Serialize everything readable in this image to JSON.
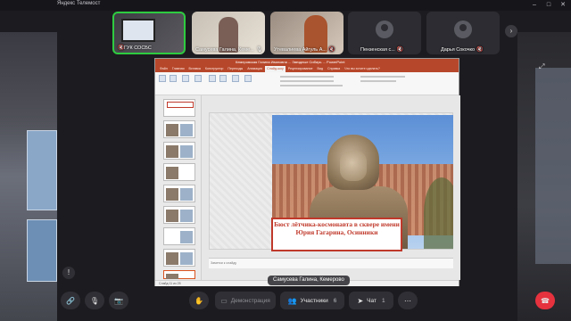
{
  "window": {
    "title": "Яндекс Телемост",
    "controls": [
      "–",
      "□",
      "✕"
    ]
  },
  "participants": [
    {
      "name": "ГУК СОСБС",
      "mic": "mic-off"
    },
    {
      "name": "Самусева Галина, Кеме...",
      "mic": "mic-on"
    },
    {
      "name": "Утевалиева Айгуль А...",
      "mic": "mic-off"
    },
    {
      "name": "Пензенская с...",
      "mic": "mic-off"
    },
    {
      "name": "Дарья Сокочко",
      "mic": "mic-off"
    }
  ],
  "presentation": {
    "window_title": "Кемеровская Галина Ивановна ... Звездные Сибирь ... PowerPoint",
    "tabs": [
      "Файл",
      "Главная",
      "Вставка",
      "Конструктор",
      "Переходы",
      "Анимация",
      "Слайд-шоу",
      "Рецензирование",
      "Вид",
      "Справка",
      "Что вы хотите сделать?"
    ],
    "active_tab": "Слайд-шоу",
    "caption": "Бюст лётчика-космонавта в сквере имени Юрия Гагарина, Осинники",
    "notes_placeholder": "Заметки к слайду",
    "status": "Слайд 11 из 25"
  },
  "presenter_label": "Самусева Галина, Кемерово",
  "toolbar": {
    "demo_label": "Демонстрация",
    "participants_label": "Участники",
    "participants_count": "6",
    "chat_label": "Чат",
    "chat_count": "1"
  },
  "colors": {
    "accent_green": "#2ecc40",
    "hangup_red": "#e5323e",
    "ppt_red": "#b7472a"
  }
}
